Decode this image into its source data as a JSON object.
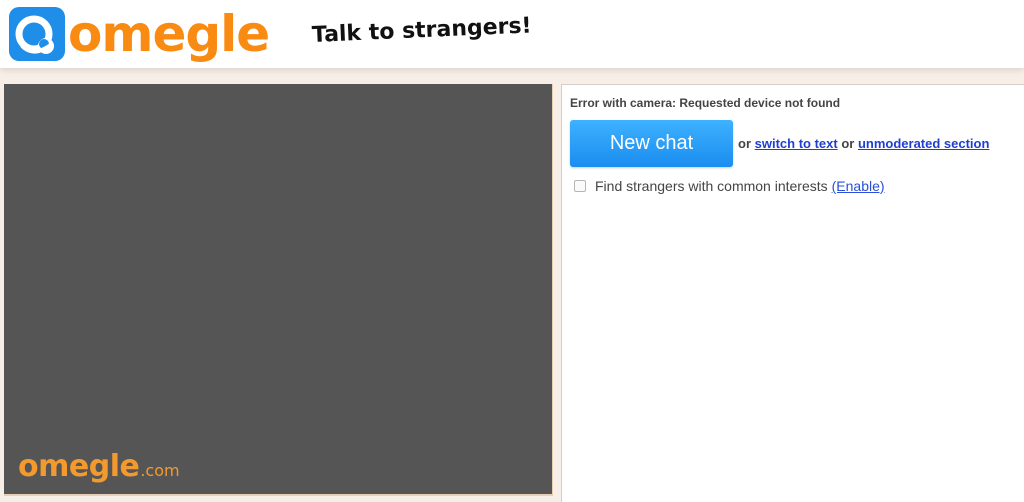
{
  "header": {
    "logo_text": "omegle",
    "tagline": "Talk to strangers!"
  },
  "video": {
    "watermark_main": "omegle",
    "watermark_suffix": ".com"
  },
  "side": {
    "error_message": "Error with camera: Requested device not found",
    "new_chat_label": "New chat",
    "or_1": "or",
    "switch_text_link": "switch to text",
    "or_2": "or",
    "unmoderated_link": "unmoderated section",
    "interests_label": "Find strangers with common interests",
    "enable_link": "(Enable)",
    "interests_checked": false
  },
  "colors": {
    "brand_orange": "#f98a12",
    "button_blue": "#1a8df0",
    "link_blue": "#1f3fd1",
    "video_bg": "#555555"
  }
}
